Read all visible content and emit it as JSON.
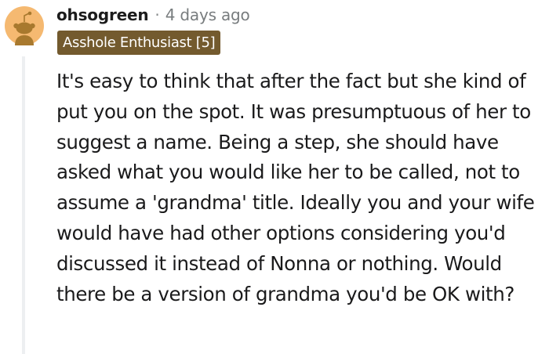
{
  "comment": {
    "author": "ohsogreen",
    "separator": "·",
    "timestamp": "4 days ago",
    "flair": "Asshole Enthusiast [5]",
    "avatar_icon": "reddit-snoo-avatar-icon",
    "body": "It's easy to think that after the fact but she kind of put you on the spot. It was presumptuous of her to suggest a name. Being a step, she should have asked what you would like her to be called, not to assume a 'grandma' title. Ideally you and your wife would have had other options considering you'd discussed it instead of Nonna or nothing. Would there be a version of grandma you'd be OK with?"
  },
  "colors": {
    "flair_background": "#735a2e",
    "avatar_background": "#f5b971",
    "thread_line": "#edeff1"
  }
}
